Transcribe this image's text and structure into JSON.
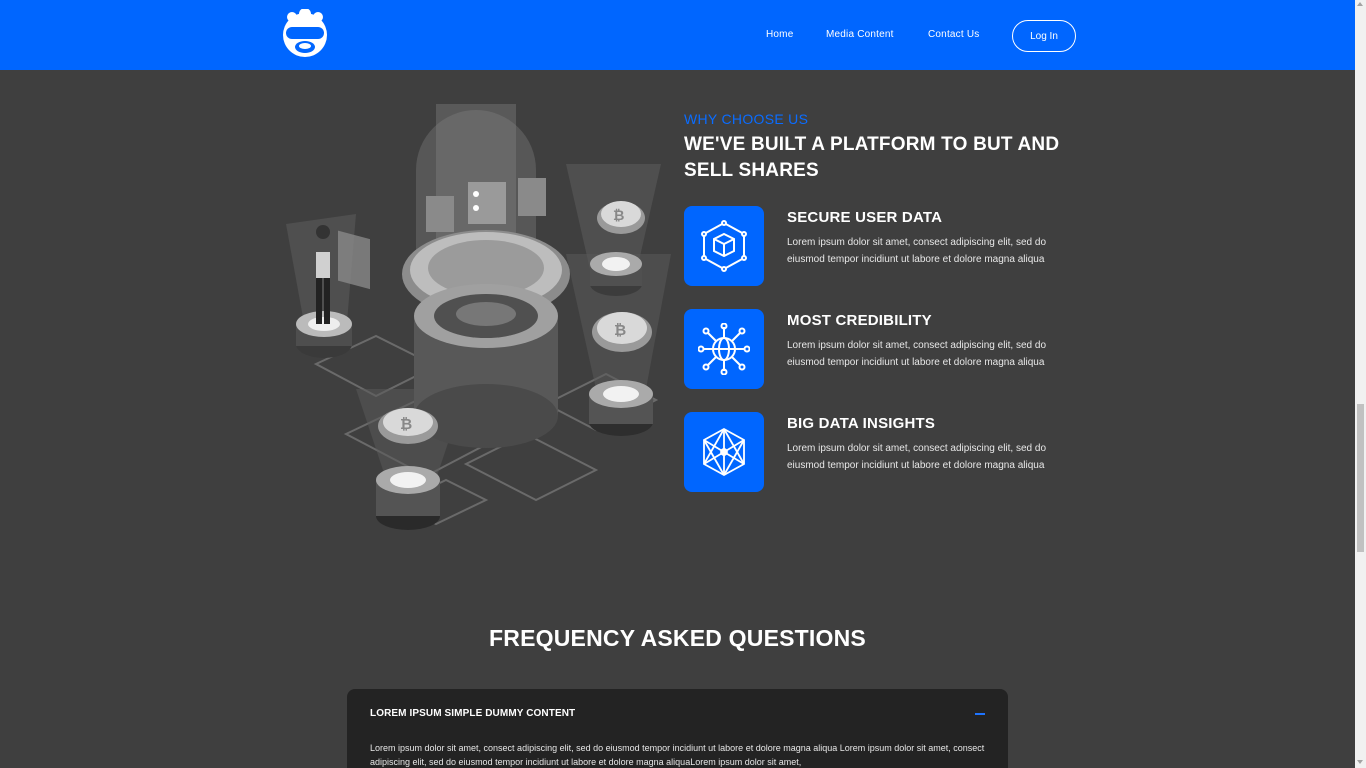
{
  "nav": {
    "links": [
      "Home",
      "Media Content",
      "Contact Us"
    ],
    "login_label": "Log In"
  },
  "why": {
    "eyebrow": "WHY CHOOSE US",
    "headline": "WE'VE BUILT A PLATFORM TO BUT AND SELL SHARES",
    "features": [
      {
        "title": "SECURE USER DATA",
        "text": "Lorem ipsum dolor sit amet, consect adipiscing elit, sed do eiusmod tempor incidiunt ut labore et dolore magna aliqua",
        "icon": "cube-icon"
      },
      {
        "title": "MOST CREDIBILITY",
        "text": "Lorem ipsum dolor sit amet, consect adipiscing elit, sed do eiusmod tempor incidiunt ut labore et dolore magna aliqua",
        "icon": "network-globe-icon"
      },
      {
        "title": "BIG DATA INSIGHTS",
        "text": "Lorem ipsum dolor sit amet, consect adipiscing elit, sed do eiusmod tempor incidiunt ut labore et dolore magna aliqua",
        "icon": "data-mesh-icon"
      }
    ]
  },
  "faq": {
    "heading": "FREQUENCY ASKED QUESTIONS",
    "items": [
      {
        "question": "LOREM IPSUM SIMPLE DUMMY CONTENT",
        "answer": "Lorem ipsum dolor sit amet, consect adipiscing elit, sed do eiusmod tempor incidiunt ut labore et dolore magna aliqua Lorem ipsum dolor sit amet, consect adipiscing elit, sed do eiusmod tempor incidiunt ut labore et dolore magna aliquaLorem ipsum dolor sit amet,"
      }
    ]
  },
  "colors": {
    "accent": "#0066ff",
    "background": "#3f3f3f",
    "card": "#232323"
  }
}
